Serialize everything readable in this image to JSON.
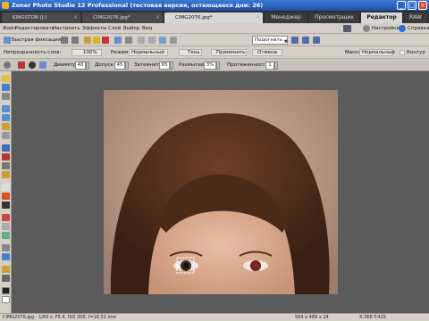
{
  "window": {
    "title": "Zoner Photo Studio 12 Professional (тестовая версия, остающееся дни: 26)",
    "controls": [
      "_",
      "□",
      "×"
    ]
  },
  "tabs": {
    "documents": [
      {
        "label": "KINGSTON (J:)",
        "active": false
      },
      {
        "label": "CIMG2076.jpg*",
        "active": false
      },
      {
        "label": "CIMG2076.jpg*",
        "active": true
      }
    ],
    "modes": [
      {
        "label": "Менеджер",
        "active": false
      },
      {
        "label": "Просмотрщик",
        "active": false
      },
      {
        "label": "Редактор",
        "active": true
      },
      {
        "label": "RAW",
        "active": false
      }
    ]
  },
  "menu": {
    "items": [
      "Файл",
      "Редактировать",
      "Настроить",
      "Эффекты",
      "Слой",
      "Выбор",
      "Вид"
    ],
    "right": [
      "Настройки",
      "Справка"
    ]
  },
  "toolbar1": {
    "quick_fix": "Быстрая фиксация…",
    "fit_select": "Подогнать"
  },
  "toolbar2": {
    "opacity_label": "Непрозрачность слоя:",
    "opacity_value": "100%",
    "mode_label": "Режим:",
    "mode_value": "Нормальный",
    "shadow_btn": "Тень",
    "apply_btn": "Применить",
    "cancel_btn": "Отмена",
    "mask_label": "Маска:",
    "mask_value": "Нормальный",
    "contour_label": "Контур"
  },
  "toolbar3": {
    "diameter_label": "Диаметр:",
    "diameter_value": "40",
    "tolerance_label": "Допуск:",
    "tolerance_value": "45",
    "darken_label": "Затемнить:",
    "darken_value": "65",
    "blur_label": "Размытие:",
    "blur_value": "3%",
    "extent_label": "Протяженность:",
    "extent_value": "1"
  },
  "status": {
    "file_info": "CIMG2076.jpg - 1/60 s, F5.4, ISO 200, f=16.51 mm",
    "dimensions": "564 x 489 x 24",
    "coords": "X:366 Y:415"
  },
  "colors": {
    "titlebar": "#1f4fa8",
    "dark_tabbar": "#2e2e2e",
    "chrome": "#d4d0c8",
    "canvas": "#5b5b5b"
  }
}
